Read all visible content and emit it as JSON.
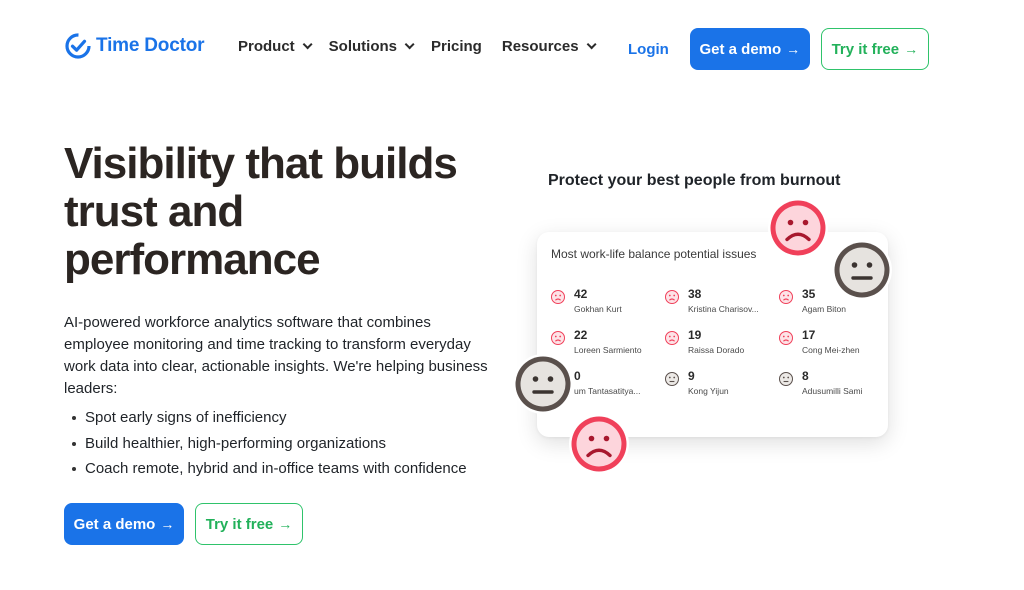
{
  "brand": {
    "name": "Time Doctor",
    "color": "#1a73e8"
  },
  "nav": {
    "items": [
      {
        "label": "Product",
        "has_dropdown": true
      },
      {
        "label": "Solutions",
        "has_dropdown": true
      },
      {
        "label": "Pricing",
        "has_dropdown": false
      },
      {
        "label": "Resources",
        "has_dropdown": true
      }
    ],
    "login": "Login",
    "demo_label": "Get a demo",
    "try_label": "Try it free",
    "arrow": "→"
  },
  "hero": {
    "title": "Visibility that builds trust and performance",
    "description": "AI-powered workforce analytics software that combines employee monitoring and time tracking to transform everyday work data into clear, actionable insights. We're helping business leaders:",
    "bullets": [
      "Spot early signs of inefficiency",
      "Build healthier, high-performing organizations",
      "Coach remote, hybrid and in-office teams with confidence"
    ],
    "demo_label": "Get a demo",
    "try_label": "Try it free",
    "arrow": "→"
  },
  "illustration": {
    "title": "Protect your best people from burnout",
    "card_title": "Most work-life balance potential issues",
    "people": [
      {
        "value": "42",
        "name": "Gokhan Kurt",
        "mood": "sad"
      },
      {
        "value": "38",
        "name": "Kristina Charisov...",
        "mood": "sad"
      },
      {
        "value": "35",
        "name": "Agam Biton",
        "mood": "sad"
      },
      {
        "value": "22",
        "name": "Loreen Sarmiento",
        "mood": "sad"
      },
      {
        "value": "19",
        "name": "Raissa Dorado",
        "mood": "sad"
      },
      {
        "value": "17",
        "name": "Cong Mei-zhen",
        "mood": "sad"
      },
      {
        "value": "0",
        "name": "um Tantasatitya...",
        "mood": "neutral"
      },
      {
        "value": "9",
        "name": "Kong Yijun",
        "mood": "neutral"
      },
      {
        "value": "8",
        "name": "Adusumilli Sami",
        "mood": "neutral"
      }
    ]
  },
  "colors": {
    "primary": "#1a73e8",
    "success": "#2fc36b",
    "sad": "#f0405a",
    "neutral": "#5a504c"
  }
}
